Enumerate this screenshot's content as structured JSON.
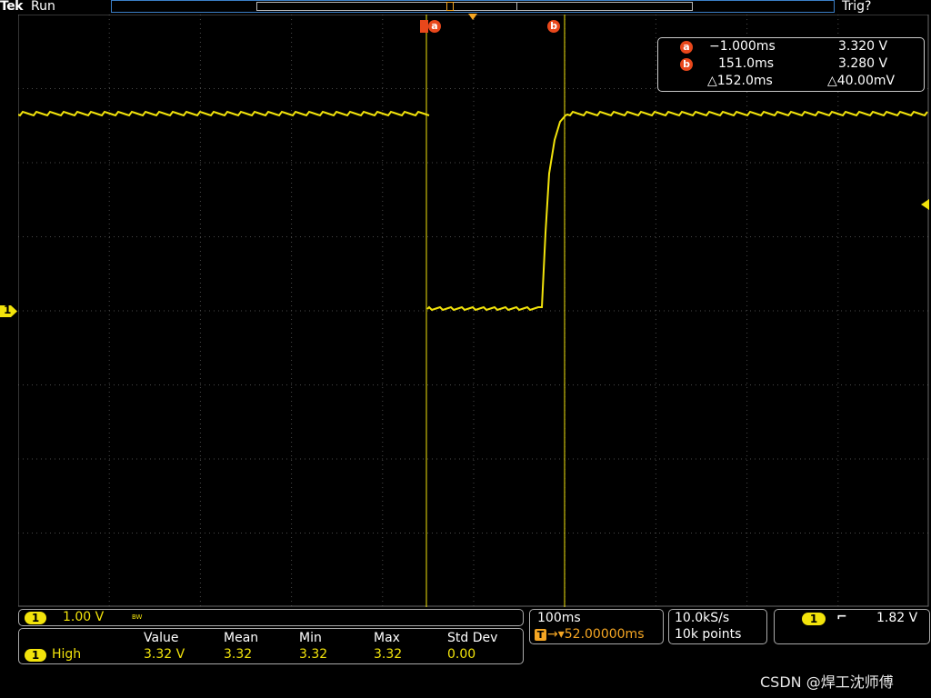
{
  "header": {
    "brand": "Tek",
    "run_state": "Run",
    "trigger_status": "Trig?"
  },
  "cursors": {
    "a": {
      "label": "a",
      "time": "−1.000ms",
      "voltage": "3.320 V"
    },
    "b": {
      "label": "b",
      "time": "151.0ms",
      "voltage": "3.280 V"
    },
    "delta": {
      "time": "△152.0ms",
      "voltage": "△40.00mV"
    }
  },
  "markers": {
    "trigger_marker": "T",
    "channel_marker": "1"
  },
  "channel": {
    "number": "1",
    "scale": "1.00 V",
    "bw_label": "BW"
  },
  "measurement": {
    "channel": "1",
    "type": "High",
    "headers": [
      "Value",
      "Mean",
      "Min",
      "Max",
      "Std Dev"
    ],
    "values": [
      "3.32 V",
      "3.32",
      "3.32",
      "3.32",
      "0.00"
    ]
  },
  "timebase": {
    "scale": "100ms",
    "position_prefix": "T",
    "position": "→▾52.00000ms"
  },
  "acquisition": {
    "rate": "10.0kS/s",
    "points": "10k points"
  },
  "trigger": {
    "channel": "1",
    "slope_symbol": "⌐",
    "level": "1.82 V"
  },
  "watermark": "CSDN @焊工沈师傅",
  "colors": {
    "trace": "#f2e30b",
    "cursor_badge": "#e8471b",
    "timebase_accent": "#f5a623",
    "record_bar": "#3b7fc7"
  }
}
